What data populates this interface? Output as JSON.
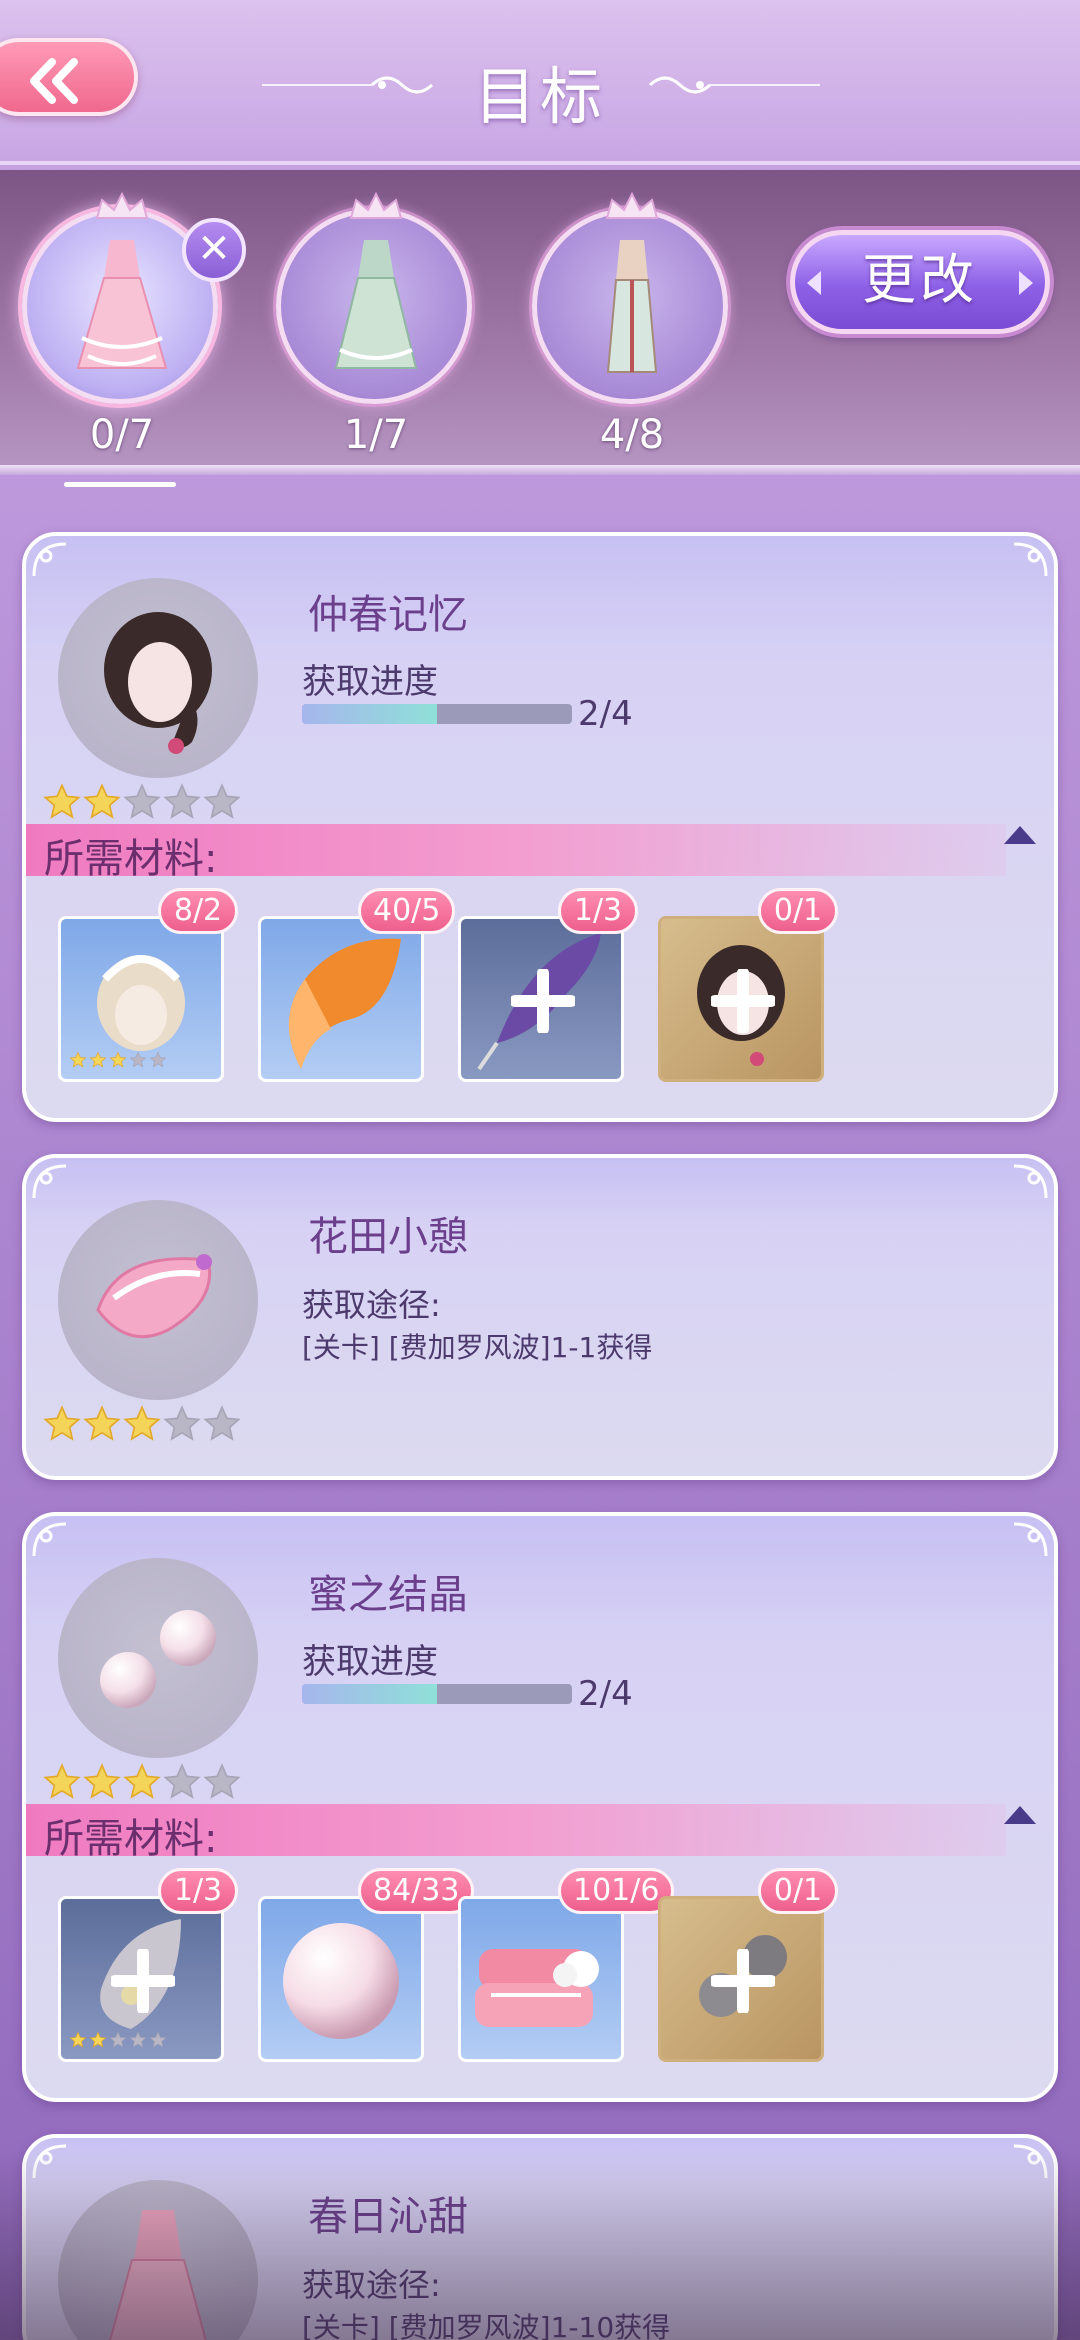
{
  "header": {
    "title": "目标",
    "back_icon": "double-chevron-left-icon"
  },
  "targets": [
    {
      "count": "0/7",
      "active": true
    },
    {
      "count": "1/7",
      "active": false
    },
    {
      "count": "4/8",
      "active": false
    }
  ],
  "change_button": {
    "label": "更改"
  },
  "colors": {
    "accent_pink": "#f07ac0",
    "accent_purple": "#8d60e6",
    "badge_pink": "#ee5f8e"
  },
  "cards": [
    {
      "name": "仲春记忆",
      "type": "progress",
      "progress_label": "获取进度",
      "progress_text": "2/4",
      "progress": 0.5,
      "stars": 2,
      "materials_label": "所需材料:",
      "materials": [
        {
          "badge": "8/2",
          "stars": 3,
          "kind": "hair-accessory"
        },
        {
          "badge": "40/5",
          "kind": "fox-tail"
        },
        {
          "badge": "1/3",
          "kind": "feather"
        },
        {
          "badge": "0/1",
          "kind": "hair"
        }
      ]
    },
    {
      "name": "花田小憩",
      "type": "route",
      "route_label": "获取途径:",
      "route_text": "[关卡] [费加罗风波]1-1获得",
      "stars": 3
    },
    {
      "name": "蜜之结晶",
      "type": "progress",
      "progress_label": "获取进度",
      "progress_text": "2/4",
      "progress": 0.5,
      "stars": 3,
      "materials_label": "所需材料:",
      "materials": [
        {
          "badge": "1/3",
          "stars": 2,
          "kind": "leaf"
        },
        {
          "badge": "84/33",
          "kind": "pearl"
        },
        {
          "badge": "101/6",
          "kind": "towel"
        },
        {
          "badge": "0/1",
          "kind": "pearls"
        }
      ]
    },
    {
      "name": "春日沁甜",
      "type": "route",
      "route_label": "获取途径:",
      "route_text": "[关卡] [费加罗风波]1-10获得"
    }
  ]
}
